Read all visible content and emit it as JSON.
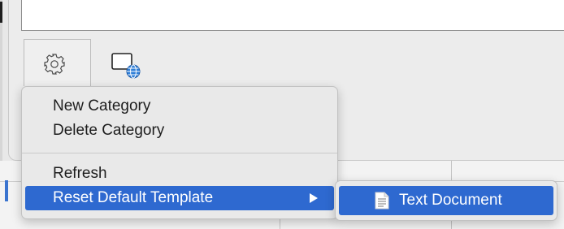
{
  "toolbar": {
    "gear_icon": "gear-icon",
    "web_icon": "web-document-icon"
  },
  "context_menu": {
    "items": [
      {
        "label": "New Category",
        "highlighted": false
      },
      {
        "label": "Delete Category",
        "highlighted": false
      },
      {
        "label": "Refresh",
        "highlighted": false
      },
      {
        "label": "Reset Default Template",
        "highlighted": true,
        "has_submenu": true
      }
    ]
  },
  "submenu": {
    "items": [
      {
        "label": "Text Document",
        "icon": "text-document-icon",
        "highlighted": true
      }
    ]
  },
  "colors": {
    "highlight": "#2e69d0",
    "menu_bg": "#e9e9e9",
    "menu_text": "#1d1d1d"
  }
}
